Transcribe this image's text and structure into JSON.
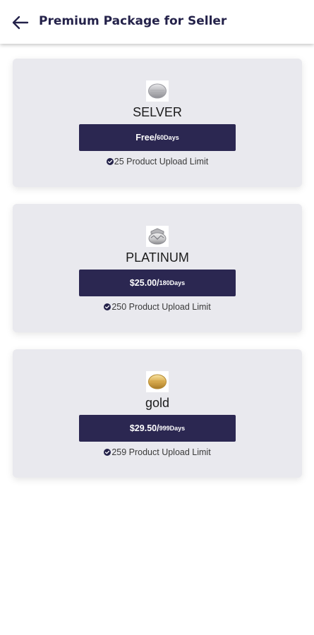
{
  "header": {
    "title": "Premium Package for Seller",
    "back_icon": "arrow-left-icon"
  },
  "colors": {
    "primary": "#2b2751",
    "card_bg": "#e9e9ee",
    "header_text": "#24224a"
  },
  "packages": [
    {
      "name": "SELVER",
      "badge_icon": "silver-medal-icon",
      "price": "Free/",
      "duration": "60Days",
      "limit": "25 Product Upload Limit"
    },
    {
      "name": "PLATINUM",
      "badge_icon": "platinum-medal-icon",
      "price": "$25.00/",
      "duration": "180Days",
      "limit": "250 Product Upload Limit"
    },
    {
      "name": "gold",
      "badge_icon": "gold-medal-icon",
      "price": "$29.50/",
      "duration": "999Days",
      "limit": "259 Product Upload Limit"
    }
  ]
}
